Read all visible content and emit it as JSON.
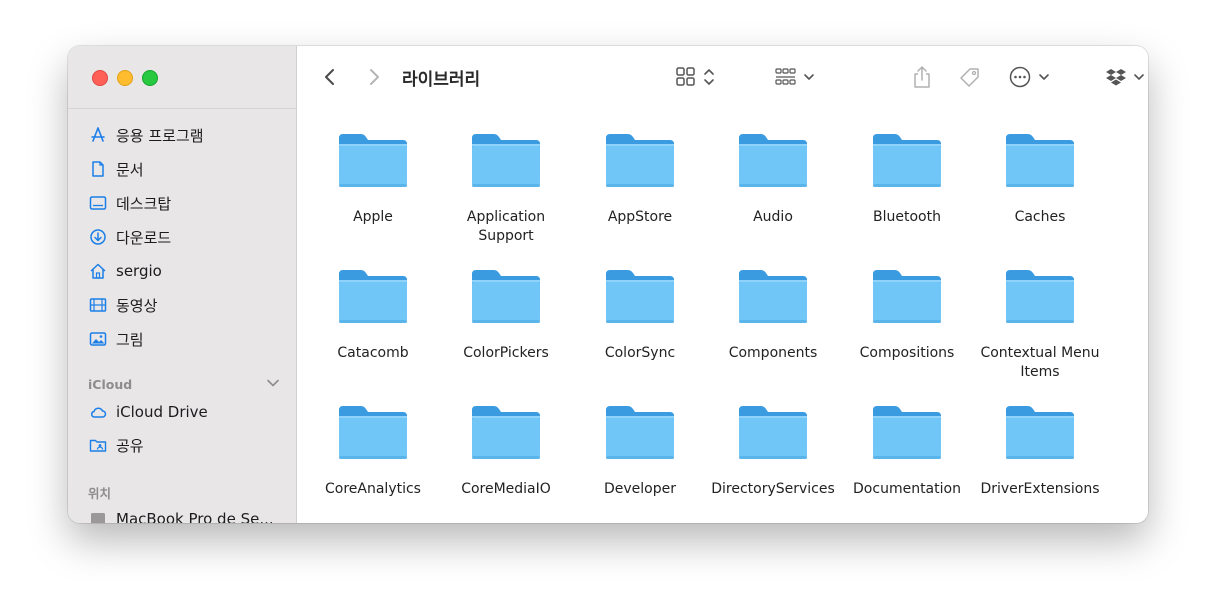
{
  "window": {
    "title": "라이브러리"
  },
  "sidebar": {
    "favorites": [
      {
        "label": "응용 프로그램",
        "icon": "applications-icon"
      },
      {
        "label": "문서",
        "icon": "document-icon"
      },
      {
        "label": "데스크탑",
        "icon": "desktop-icon"
      },
      {
        "label": "다운로드",
        "icon": "download-icon"
      },
      {
        "label": "sergio",
        "icon": "home-icon"
      },
      {
        "label": "동영상",
        "icon": "film-icon"
      },
      {
        "label": "그림",
        "icon": "photo-icon"
      }
    ],
    "icloud_header": "iCloud",
    "icloud": [
      {
        "label": "iCloud Drive",
        "icon": "cloud-icon"
      },
      {
        "label": "공유",
        "icon": "shared-folder-icon"
      }
    ],
    "locations_header": "위치",
    "locations": [
      {
        "label": "MacBook Pro de Se...",
        "icon": "laptop-icon"
      }
    ]
  },
  "folders": [
    {
      "label": "Apple"
    },
    {
      "label": "Application Support"
    },
    {
      "label": "AppStore"
    },
    {
      "label": "Audio"
    },
    {
      "label": "Bluetooth"
    },
    {
      "label": "Caches"
    },
    {
      "label": "Catacomb"
    },
    {
      "label": "ColorPickers"
    },
    {
      "label": "ColorSync"
    },
    {
      "label": "Components"
    },
    {
      "label": "Compositions"
    },
    {
      "label": "Contextual Menu Items"
    },
    {
      "label": "CoreAnalytics"
    },
    {
      "label": "CoreMediaIO"
    },
    {
      "label": "Developer"
    },
    {
      "label": "DirectoryServices"
    },
    {
      "label": "Documentation"
    },
    {
      "label": "DriverExtensions"
    }
  ],
  "colors": {
    "accent": "#1a7fe8",
    "folder_front": "#6fc6f7",
    "folder_back": "#3a9be0"
  }
}
